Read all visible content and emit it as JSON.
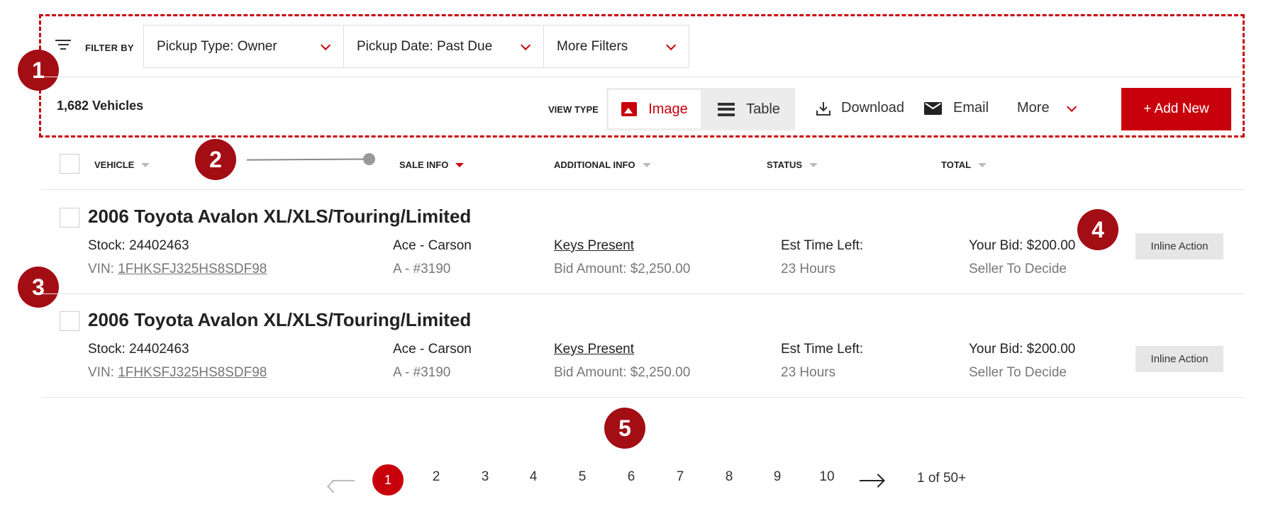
{
  "filter_bar": {
    "label": "FILTER BY",
    "filters": [
      "Pickup Type: Owner",
      "Pickup Date: Past Due",
      "More Filters"
    ]
  },
  "toolbar": {
    "vehicle_count": "1,682 Vehicles",
    "view_type_label": "VIEW TYPE",
    "view_image": "Image",
    "view_table": "Table",
    "download": "Download",
    "email": "Email",
    "more": "More",
    "add_new": "+ Add New"
  },
  "table": {
    "headers": [
      "VEHICLE",
      "SALE INFO",
      "ADDITIONAL INFO",
      "STATUS",
      "TOTAL"
    ],
    "rows": [
      {
        "title": "2006 Toyota Avalon XL/XLS/Touring/Limited",
        "stock": "Stock: 24402463",
        "vin_label": "VIN: ",
        "vin": "1FHKSFJ325HS8SDF98",
        "sale_location": "Ace - Carson",
        "sale_lane": "A - #3190",
        "keys": "Keys Present",
        "bid_amount": "Bid Amount: $2,250.00",
        "status_label": "Est Time Left:",
        "status_value": "23 Hours",
        "your_bid": "Your Bid: $200.00",
        "decision": "Seller To Decide",
        "action": "Inline Action"
      },
      {
        "title": "2006 Toyota Avalon XL/XLS/Touring/Limited",
        "stock": "Stock: 24402463",
        "vin_label": "VIN: ",
        "vin": "1FHKSFJ325HS8SDF98",
        "sale_location": "Ace - Carson",
        "sale_lane": "A - #3190",
        "keys": "Keys Present",
        "bid_amount": "Bid Amount: $2,250.00",
        "status_label": "Est Time Left:",
        "status_value": "23 Hours",
        "your_bid": "Your Bid: $200.00",
        "decision": "Seller To Decide",
        "action": "Inline Action"
      }
    ]
  },
  "pagination": {
    "pages": [
      "1",
      "2",
      "3",
      "4",
      "5",
      "6",
      "7",
      "8",
      "9",
      "10"
    ],
    "current": "1",
    "summary": "1 of 50+"
  },
  "annotations": [
    "1",
    "2",
    "3",
    "4",
    "5"
  ],
  "colors": {
    "accent": "#c8000c",
    "marker": "#a30d14"
  }
}
